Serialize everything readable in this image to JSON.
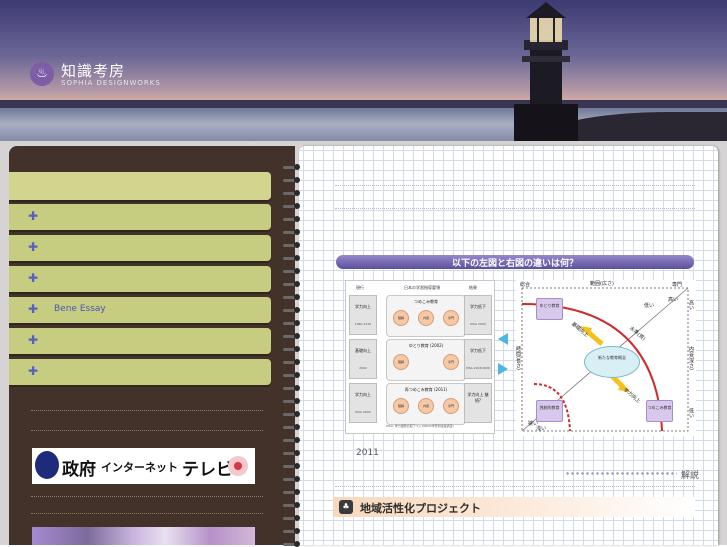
{
  "header": {
    "logo_mark": "♨",
    "logo_title": "知識考房",
    "logo_subtitle": "SOPHIA DESIGNWORKS"
  },
  "sidebar": {
    "menu": [
      {
        "label": ""
      },
      {
        "label": ""
      },
      {
        "label": ""
      },
      {
        "label": ""
      },
      {
        "label": "Bene Essay"
      },
      {
        "label": ""
      },
      {
        "label": ""
      }
    ],
    "tv_banner": {
      "part1": "政府",
      "part2": "インターネット",
      "part3": "テレビ"
    }
  },
  "main": {
    "question": "以下の左図と右図の違いは何？",
    "left_diagram": {
      "col_current": "現行",
      "col_course": "日本の学習指導要領",
      "col_result": "結果",
      "rows": [
        {
          "left": "学力向上",
          "left_year": "1960-1970",
          "era": "つめこみ教育",
          "items": [
            "理解",
            "内容",
            "専門"
          ],
          "right": "学力低下",
          "right_year": "PISA 2000"
        },
        {
          "left": "基礎向上",
          "left_year": "2002",
          "era": "ゆとり教育 (2002)",
          "items": [
            "理解",
            "",
            "専門"
          ],
          "right": "学力低下",
          "right_year": "PISA 2003/2006"
        },
        {
          "left": "学力向上",
          "left_year": "PISA 2009",
          "era": "再つめこみ教育 (2011)",
          "items": [
            "理解",
            "内容",
            "専門"
          ],
          "right": "学力向上 継続?",
          "right_year": ""
        }
      ],
      "caption": "PISA: 学力国際比較テスト(OECD学習到達度調査)"
    },
    "right_diagram": {
      "top_axis": "範囲(広さ)",
      "top_left": "総合",
      "top_right": "専門",
      "left_axis": "時間(長さ)",
      "right_axis": "内容(深さ)",
      "bottom_left": "狭い",
      "bottom_left2": "浅い",
      "right_top": "高い",
      "right_bottom": "低い",
      "center": "新たな教育概念",
      "box_tl": "ゆとり教育",
      "box_bl": "独創的教育",
      "box_br": "つめこみ教育",
      "arrow_up": "基礎向上",
      "arrow_down": "学力向上",
      "diag_label": "水準(質)",
      "low": "低い",
      "high": "高い"
    },
    "year": "2011",
    "explain_label": "解説",
    "project_label": "地域活性化プロジェクト"
  }
}
